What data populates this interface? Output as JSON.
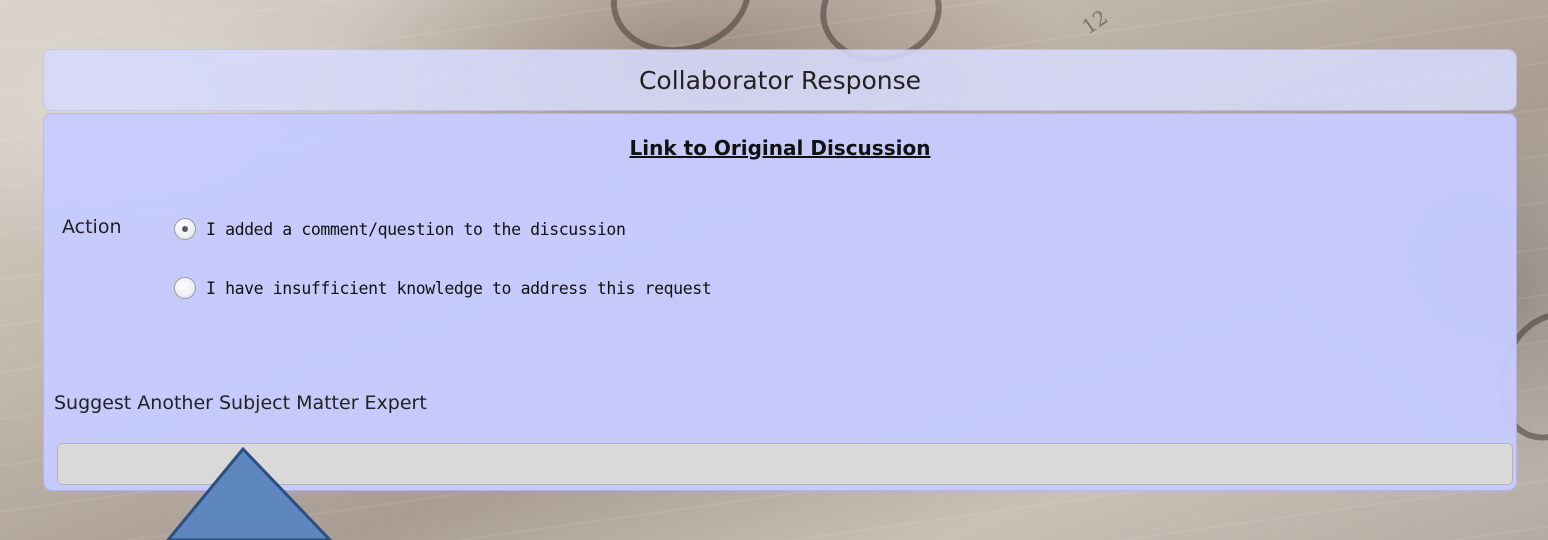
{
  "background": {
    "calendar_number": "12"
  },
  "header": {
    "title": "Collaborator Response"
  },
  "form": {
    "link_label": "Link to Original Discussion",
    "action_label": "Action",
    "options": [
      {
        "label": "I added a comment/question to the discussion",
        "selected": true
      },
      {
        "label": "I have insufficient knowledge to address this request",
        "selected": false
      }
    ],
    "suggest_label": "Suggest Another Subject Matter Expert",
    "suggest_value": "",
    "suggest_placeholder": ""
  },
  "colors": {
    "panel_header": "#d6dafc",
    "panel_body": "#c6cbff",
    "input_bg": "#d9d9d9",
    "callout_fill": "#5e87bf",
    "callout_stroke": "#2d4f80"
  }
}
